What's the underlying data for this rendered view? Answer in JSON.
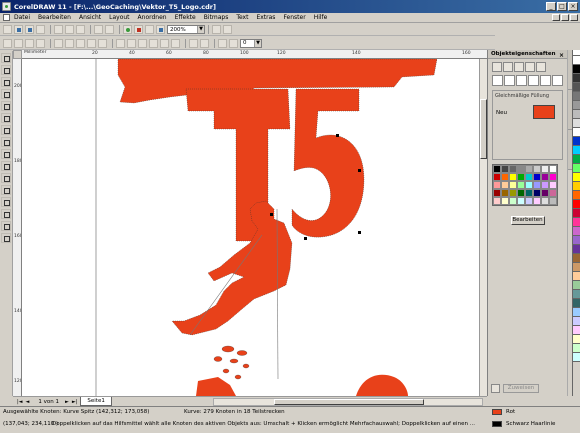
{
  "window": {
    "title": "CorelDRAW 11 - [F:\\...\\GeoCaching\\Vektor_T5_Logo.cdr]"
  },
  "menu": [
    "Datei",
    "Bearbeiten",
    "Ansicht",
    "Layout",
    "Anordnen",
    "Effekte",
    "Bitmaps",
    "Text",
    "Extras",
    "Fenster",
    "Hilfe"
  ],
  "toolbar": {
    "zoom": "200%",
    "outline_width": "0"
  },
  "rulers": {
    "h_labels": [
      "20",
      "40",
      "60",
      "80",
      "100",
      "120",
      "140",
      "160"
    ],
    "h_unit": "Millimeter",
    "v_labels": [
      "200",
      "180",
      "160",
      "140",
      "120"
    ],
    "v_unit": "Millimeter"
  },
  "artwork": {
    "text": "T5",
    "color": "#e8411a"
  },
  "pagebar": {
    "page_info": "1 von 1",
    "page_tab": "Seite1"
  },
  "docker": {
    "title": "Objekteigenschaften",
    "group_label": "Gleichmäßige Füllung",
    "new_label": "Neu",
    "new_color": "#e8411a",
    "edit_button": "Bearbeiten",
    "apply_button": "Zuweisen"
  },
  "status": {
    "line1_left": "Ausgewählte Knoten: Kurve Spitz (142,312; 173,058)",
    "line1_mid": "Kurve: 279 Knoten in 18 Teilstrecken",
    "fill_label": "Rot",
    "fill_color": "#e8411a",
    "line2_left": "(137,043; 234,110 )",
    "line2_hint": "Doppelklicken auf das Hilfsmittel wählt alle Knoten des aktiven Objekts aus: Umschalt + Klicken ermöglicht Mehrfachauswahl; Doppelklicken auf einen ...",
    "outline_label": "Schwarz  Haarlinie",
    "outline_color": "#000000"
  }
}
